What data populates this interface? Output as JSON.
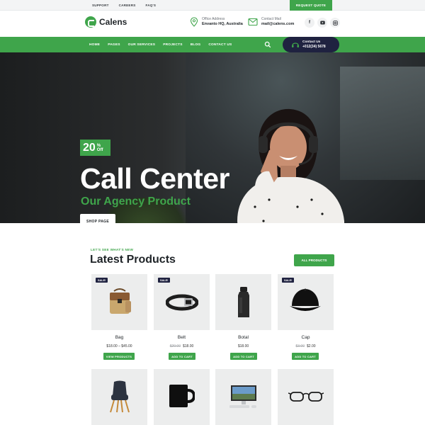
{
  "topbar": {
    "links": [
      "SUPPORT",
      "CAREERS",
      "FAQ'S"
    ],
    "request_quote": "REQUEST QUOTE"
  },
  "header": {
    "logo_text": "Calens",
    "office": {
      "label": "Office Address",
      "value": "Envanto HQ, Australia"
    },
    "mail": {
      "label": "Contact Mail",
      "value": "mail@calens.com"
    },
    "socials": [
      "facebook-icon",
      "youtube-icon",
      "instagram-icon"
    ]
  },
  "nav": {
    "items": [
      "HOME",
      "PAGES",
      "OUR SERVICES",
      "PROJECTS",
      "BLOG",
      "CONTACT US"
    ],
    "contact": {
      "label": "Contact Us",
      "number": "+012(34) 5678"
    }
  },
  "hero": {
    "badge_number": "20",
    "badge_pct": "%",
    "badge_off": "Off",
    "title": "Call Center",
    "subtitle": "Our Agency Product",
    "button": "SHOP PAGE",
    "slides": 2,
    "active_slide": 1
  },
  "products": {
    "kicker": "LET'S SEE WHAT'S NEW",
    "title": "Latest Products",
    "all_button": "ALL PRODUCTS",
    "sale_label": "SALE!",
    "items": [
      {
        "name": "Bag",
        "old_price": "",
        "price": "$18.00 – $45.00",
        "sale": true,
        "button": "VIEW PRODUCTS"
      },
      {
        "name": "Belt",
        "old_price": "$20.00",
        "price": "$18.00",
        "sale": true,
        "button": "ADD TO CART"
      },
      {
        "name": "Botal",
        "old_price": "",
        "price": "$18.00",
        "sale": false,
        "button": "ADD TO CART"
      },
      {
        "name": "Cap",
        "old_price": "$3.00",
        "price": "$2.00",
        "sale": true,
        "button": "ADD TO CART"
      },
      {
        "name": "Chair"
      },
      {
        "name": "Mug"
      },
      {
        "name": "Computer"
      },
      {
        "name": "Glasses"
      }
    ]
  },
  "colors": {
    "brand_green": "#3fa54b",
    "navy": "#1f2240",
    "card_bg": "#eceded"
  }
}
